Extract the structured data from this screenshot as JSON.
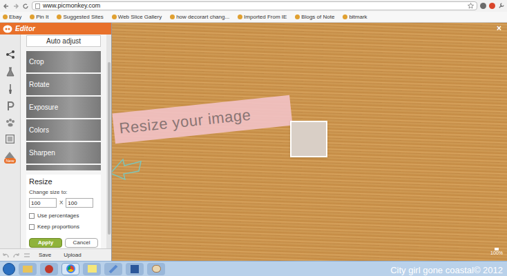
{
  "browser": {
    "address": "www.picmonkey.com",
    "bookmarks": [
      {
        "label": "Ebay"
      },
      {
        "label": "Pin It"
      },
      {
        "label": "Suggested Sites"
      },
      {
        "label": "Web Slice Gallery"
      },
      {
        "label": "how decorart chang..."
      },
      {
        "label": "Imported From IE"
      },
      {
        "label": "Blogs of Note"
      },
      {
        "label": "bitmark"
      }
    ]
  },
  "app": {
    "title": "Editor",
    "new_badge": "New",
    "auto_adjust": "Auto adjust",
    "tools": [
      {
        "label": "Crop"
      },
      {
        "label": "Rotate"
      },
      {
        "label": "Exposure"
      },
      {
        "label": "Colors"
      },
      {
        "label": "Sharpen"
      },
      {
        "label": ""
      }
    ],
    "resize": {
      "title": "Resize",
      "prompt": "Change size to:",
      "width": "100",
      "x_label": "X",
      "height": "100",
      "options": [
        {
          "label": "Use percentages",
          "checked": false
        },
        {
          "label": "Keep proportions",
          "checked": false
        }
      ],
      "apply": "Apply",
      "cancel": "Cancel"
    },
    "bottom": {
      "save": "Save",
      "upload": "Upload"
    }
  },
  "canvas": {
    "annotation": "Resize your image",
    "close": "×",
    "zoom": "100%"
  },
  "watermark": "City girl gone coastal© 2012"
}
